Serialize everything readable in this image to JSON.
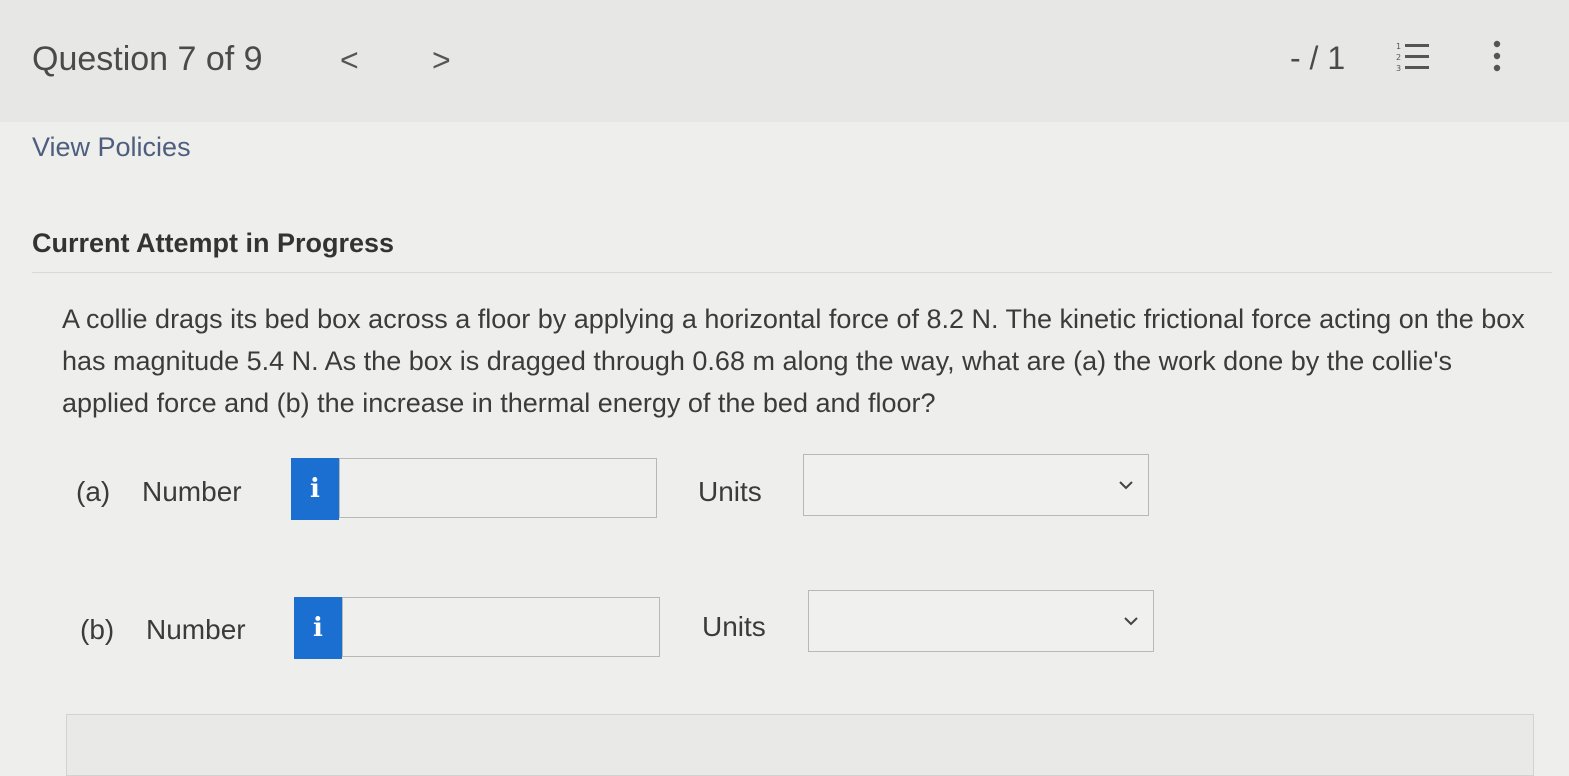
{
  "header": {
    "title": "Question 7 of 9",
    "prev_glyph": "<",
    "next_glyph": ">",
    "score": "- / 1",
    "list_icon": "numbered-list-icon",
    "more_icon": "vertical-ellipsis-icon"
  },
  "links": {
    "view_policies": "View Policies"
  },
  "attempt": {
    "status": "Current Attempt in Progress"
  },
  "question": {
    "text": "A collie drags its bed box across a floor by applying a horizontal force of 8.2 N. The kinetic frictional force acting on the box has magnitude 5.4 N. As the box is dragged through 0.68 m along the way, what are (a) the work done by the collie's applied force and (b) the increase in thermal energy of the bed and floor?"
  },
  "parts": [
    {
      "label": "(a)",
      "number_label": "Number",
      "info_glyph": "i",
      "input_value": "",
      "units_label": "Units",
      "units_selected": ""
    },
    {
      "label": "(b)",
      "number_label": "Number",
      "info_glyph": "i",
      "input_value": "",
      "units_label": "Units",
      "units_selected": ""
    }
  ],
  "colors": {
    "accent": "#1b6fd0",
    "link": "#4d5e7e",
    "background": "#eeeeec"
  }
}
